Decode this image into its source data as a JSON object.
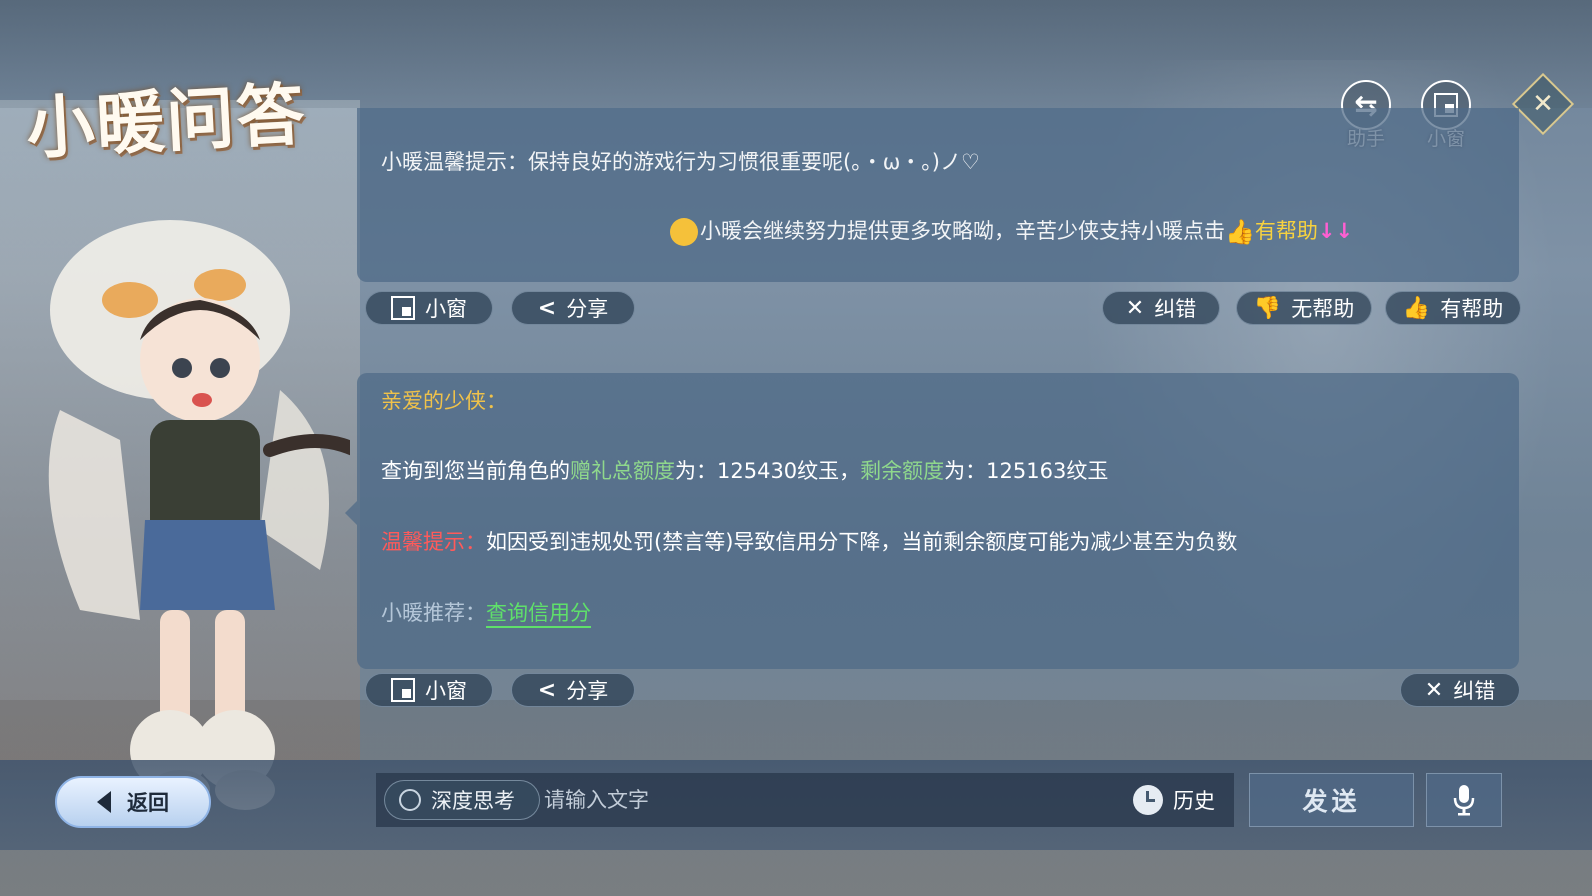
{
  "title": "小暖问答",
  "top_icons": {
    "assistant_label": "助手",
    "assistant_icon": "swap-arrows-icon",
    "small_window_label": "小窗",
    "small_window_icon": "window-icon",
    "close_icon": "close-icon"
  },
  "message1": {
    "line1": "小暖温馨提示：保持良好的游戏行为习惯很重要呢(。・ω・。)ノ♡",
    "line2_text": "小暖会继续努力提供更多攻略呦，辛苦少侠支持小暖点击",
    "line2_highlight": "有帮助",
    "line2_arrows": "↓↓",
    "line2_emoji": "kiss-face-icon",
    "line2_thumb": "thumbs-up-icon"
  },
  "message1_actions": {
    "small_window": "小窗",
    "share": "分享",
    "correct": "纠错",
    "not_helpful": "无帮助",
    "helpful": "有帮助"
  },
  "message2": {
    "greeting": "亲爱的少侠：",
    "query_prefix": "查询到您当前角色的",
    "query_total_label": "赠礼总额度",
    "query_total_mid": "为：125430纹玉，",
    "query_remain_label": "剩余额度",
    "query_remain_value": "为：125163纹玉",
    "tip_label": "温馨提示：",
    "tip_text": "如因受到违规处罚(禁言等)导致信用分下降，当前剩余额度可能为减少甚至为负数",
    "rec_label": "小暖推荐：",
    "rec_link": "查询信用分"
  },
  "message2_actions": {
    "small_window": "小窗",
    "share": "分享",
    "correct": "纠错"
  },
  "bottom": {
    "back_label": "返回",
    "deep_think_label": "深度思考",
    "input_placeholder": "请输入文字",
    "input_value": "",
    "history_label": "历史",
    "send_label": "发送"
  },
  "colors": {
    "panel": "#4e6987",
    "highlight_yellow": "#f7d23f",
    "greeting_gold": "#f0c24a",
    "keyword_green": "#8fd88c",
    "warning_red": "#ff5a5a",
    "link_green": "#5fe06a",
    "arrow_pink": "#ff5fd2"
  }
}
